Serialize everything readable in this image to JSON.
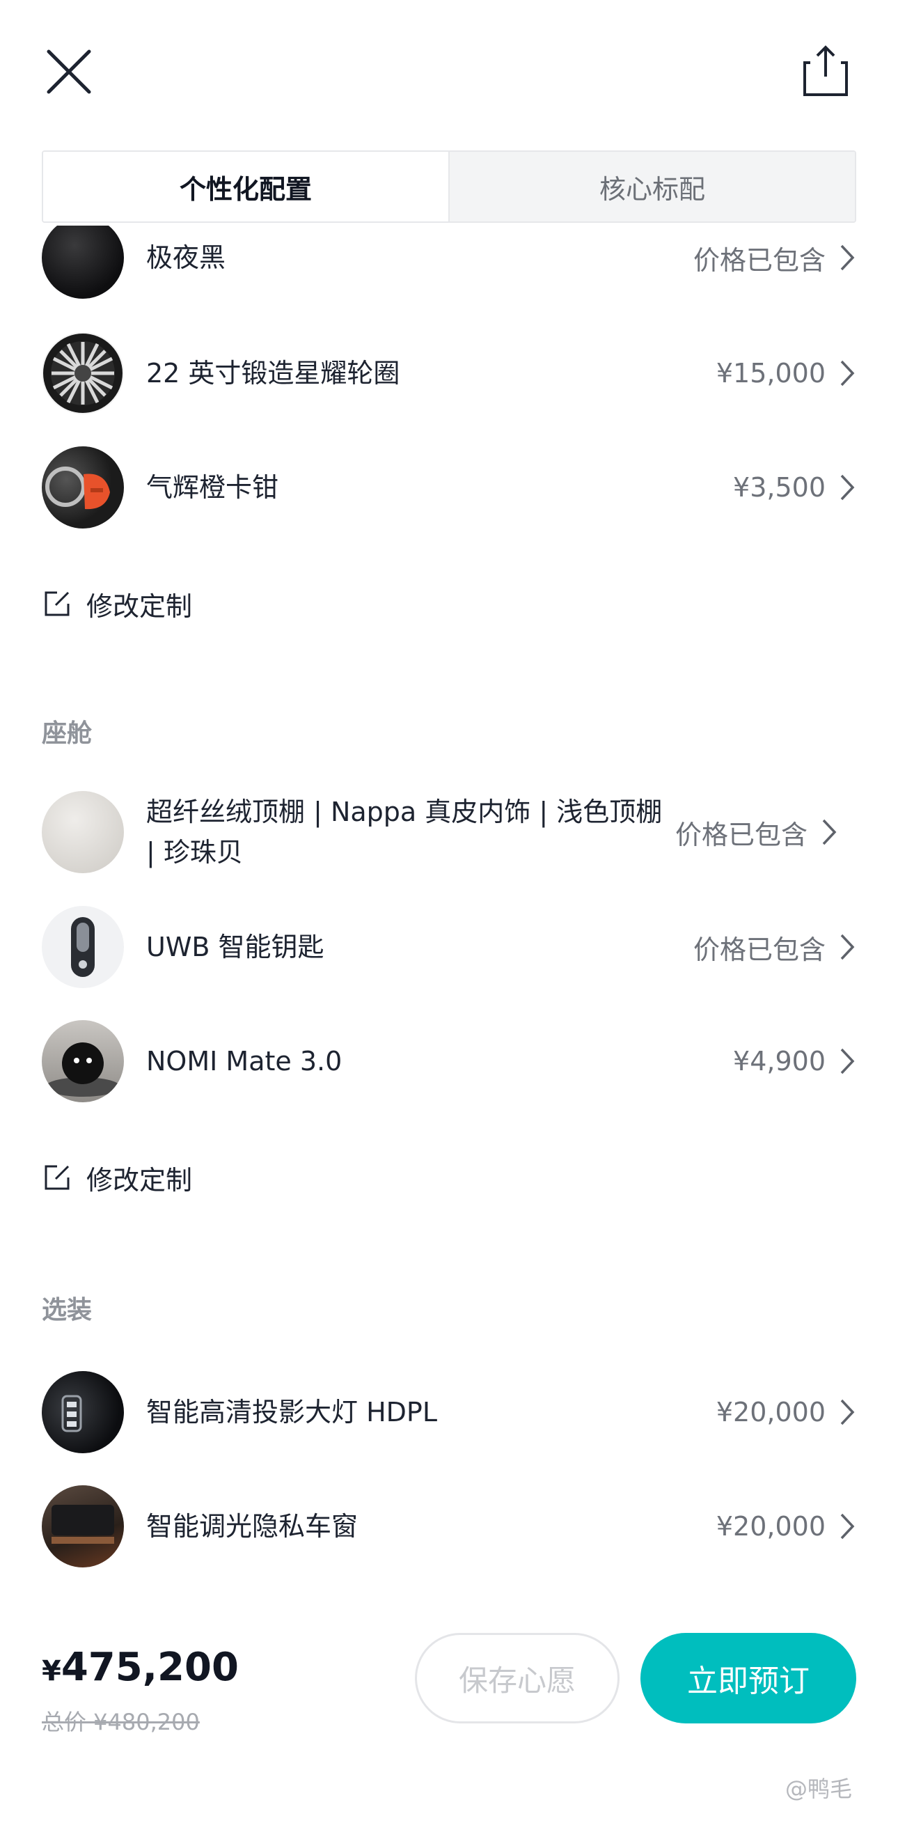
{
  "header": {
    "close_icon": "close-icon",
    "share_icon": "share-icon"
  },
  "tabs": [
    {
      "label": "个性化配置",
      "active": true
    },
    {
      "label": "核心标配",
      "active": false
    }
  ],
  "exterior": {
    "items": [
      {
        "label": "极夜黑",
        "price": "价格已包含",
        "icon": "black-paint-swatch"
      },
      {
        "label": "22 英寸锻造星耀轮圈",
        "price": "¥15,000",
        "icon": "wheel-rim"
      },
      {
        "label": "气辉橙卡钳",
        "price": "¥3,500",
        "icon": "orange-brake-caliper"
      }
    ],
    "edit_label": "修改定制"
  },
  "cabin": {
    "title": "座舱",
    "items": [
      {
        "label": "超纤丝绒顶棚 | Nappa 真皮内饰 | 浅色顶棚 | 珍珠贝",
        "price": "价格已包含",
        "icon": "pearl-fabric-swatch"
      },
      {
        "label": "UWB 智能钥匙",
        "price": "价格已包含",
        "icon": "smart-key"
      },
      {
        "label": "NOMI Mate 3.0",
        "price": "¥4,900",
        "icon": "nomi-robot"
      }
    ],
    "edit_label": "修改定制"
  },
  "options": {
    "title": "选装",
    "items": [
      {
        "label": "智能高清投影大灯 HDPL",
        "price": "¥20,000",
        "icon": "headlight"
      },
      {
        "label": "智能调光隐私车窗",
        "price": "¥20,000",
        "icon": "privacy-window"
      }
    ]
  },
  "footer": {
    "price_currency": "¥",
    "price_value": "475,200",
    "total_label": "总价 ¥480,200",
    "save_label": "保存心愿",
    "order_label": "立即预订",
    "accent_color": "#00bebe"
  },
  "watermark": "@鸭毛"
}
